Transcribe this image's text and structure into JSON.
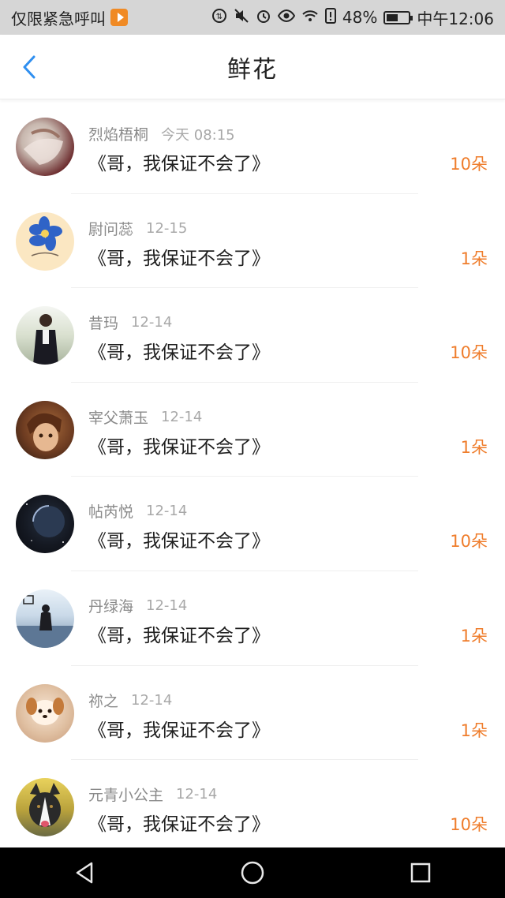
{
  "status_bar": {
    "carrier_text": "仅限紧急呼叫",
    "battery_percent": "48%",
    "time": "中午12:06",
    "icons": [
      "play-icon",
      "data-saver-icon",
      "mute-icon",
      "alarm-icon",
      "eye-icon",
      "wifi-icon",
      "sim-alert-icon",
      "battery-icon"
    ]
  },
  "header": {
    "title": "鲜花",
    "back_icon": "chevron-left-icon",
    "accent_color": "#2f8ff0"
  },
  "list": {
    "items": [
      {
        "name": "烈焰梧桐",
        "time": "今天 08:15",
        "message": "《哥，我保证不会了》",
        "count": "10朵"
      },
      {
        "name": "尉问蕊",
        "time": "12-15",
        "message": "《哥，我保证不会了》",
        "count": "1朵"
      },
      {
        "name": "昔玛",
        "time": "12-14",
        "message": "《哥，我保证不会了》",
        "count": "10朵"
      },
      {
        "name": "宰父萧玉",
        "time": "12-14",
        "message": "《哥，我保证不会了》",
        "count": "1朵"
      },
      {
        "name": "帖芮悦",
        "time": "12-14",
        "message": "《哥，我保证不会了》",
        "count": "10朵"
      },
      {
        "name": "丹绿海",
        "time": "12-14",
        "message": "《哥，我保证不会了》",
        "count": "1朵"
      },
      {
        "name": "祢之",
        "time": "12-14",
        "message": "《哥，我保证不会了》",
        "count": "1朵"
      },
      {
        "name": "元青小公主",
        "time": "12-14",
        "message": "《哥，我保证不会了》",
        "count": "10朵"
      }
    ],
    "count_color": "#ef7d2c"
  },
  "nav_bar": {
    "icons": [
      "back-triangle-icon",
      "home-circle-icon",
      "recents-square-icon"
    ]
  }
}
